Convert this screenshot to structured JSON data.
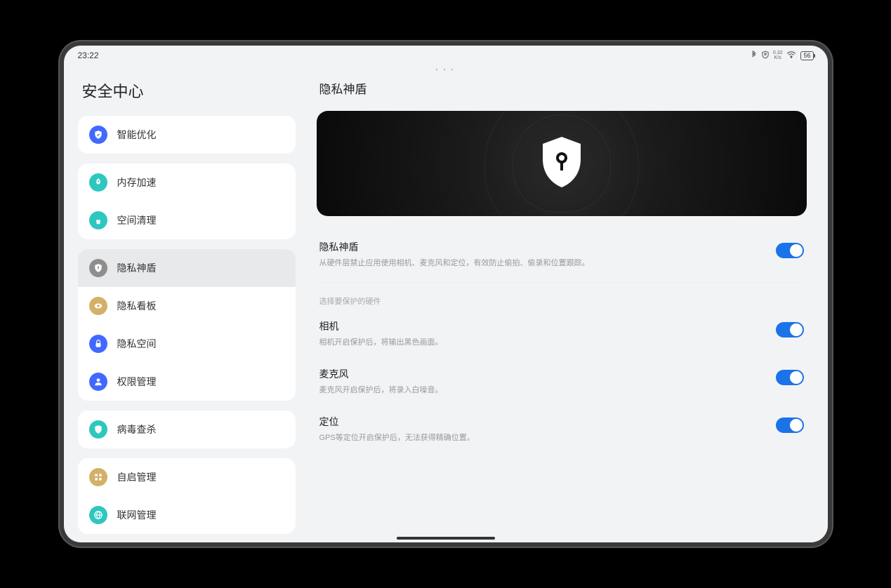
{
  "status": {
    "time": "23:22",
    "speed_value": "0.32",
    "speed_unit": "K/s",
    "battery": "56"
  },
  "sidebar": {
    "title": "安全中心",
    "groups": [
      {
        "items": [
          {
            "id": "optimize",
            "label": "智能优化",
            "color": "#4169ff",
            "icon": "shield-check"
          }
        ]
      },
      {
        "items": [
          {
            "id": "memory",
            "label": "内存加速",
            "color": "#2ec7c0",
            "icon": "rocket"
          },
          {
            "id": "storage",
            "label": "空间清理",
            "color": "#2ec7c0",
            "icon": "broom"
          }
        ]
      },
      {
        "items": [
          {
            "id": "privacy-shield",
            "label": "隐私神盾",
            "color": "#8e8e8e",
            "icon": "shield",
            "selected": true
          },
          {
            "id": "privacy-board",
            "label": "隐私看板",
            "color": "#d4b068",
            "icon": "eye"
          },
          {
            "id": "privacy-space",
            "label": "隐私空间",
            "color": "#4169ff",
            "icon": "lock"
          },
          {
            "id": "permissions",
            "label": "权限管理",
            "color": "#4169ff",
            "icon": "person"
          }
        ]
      },
      {
        "items": [
          {
            "id": "virus",
            "label": "病毒查杀",
            "color": "#2ec7c0",
            "icon": "shield-virus"
          }
        ]
      },
      {
        "items": [
          {
            "id": "autostart",
            "label": "自启管理",
            "color": "#d4b068",
            "icon": "apps"
          },
          {
            "id": "network",
            "label": "联网管理",
            "color": "#2ec7c0",
            "icon": "globe"
          }
        ]
      }
    ]
  },
  "main": {
    "title": "隐私神盾",
    "master": {
      "title": "隐私神盾",
      "desc": "从硬件层禁止应用使用相机、麦克风和定位，有效防止偷拍、偷录和位置跟踪。",
      "on": true
    },
    "hint": "选择要保护的硬件",
    "options": [
      {
        "id": "camera",
        "title": "相机",
        "desc": "相机开启保护后，将输出黑色画面。",
        "on": true
      },
      {
        "id": "mic",
        "title": "麦克风",
        "desc": "麦克风开启保护后，将录入白噪音。",
        "on": true
      },
      {
        "id": "location",
        "title": "定位",
        "desc": "GPS等定位开启保护后，无法获得精确位置。",
        "on": true
      }
    ]
  }
}
